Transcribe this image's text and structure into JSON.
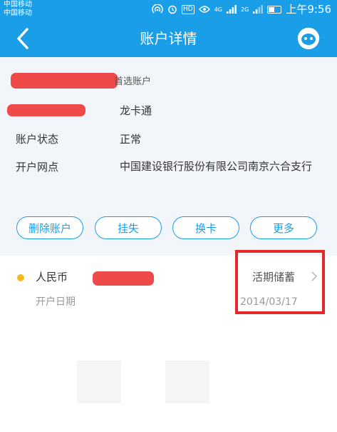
{
  "status_bar": {
    "carrier_1": "中国移动",
    "carrier_2": "中国移动",
    "hd_badge": "HD",
    "net_1": "4G",
    "net_2": "2G",
    "time": "上午9:56"
  },
  "nav": {
    "title": "账户详情",
    "back_icon": "chevron-left-icon",
    "service_icon": "customer-service-icon"
  },
  "account": {
    "preferred_label": "首选账户",
    "card_type": "龙卡通",
    "status_label": "账户状态",
    "status_value": "正常",
    "branch_label": "开户网点",
    "branch_value": "中国建设银行股份有限公司南京六合支行"
  },
  "actions": {
    "delete": "删除账户",
    "report_loss": "挂失",
    "replace_card": "换卡",
    "more": "更多"
  },
  "sub_account": {
    "currency": "人民币",
    "type": "活期储蓄",
    "open_date_label": "开户日期",
    "open_date": "2014/03/17"
  },
  "colors": {
    "primary": "#1a9ee8",
    "redaction": "#ef4a4a",
    "highlight": "#e4282b",
    "currency_dot": "#f5b81e"
  }
}
